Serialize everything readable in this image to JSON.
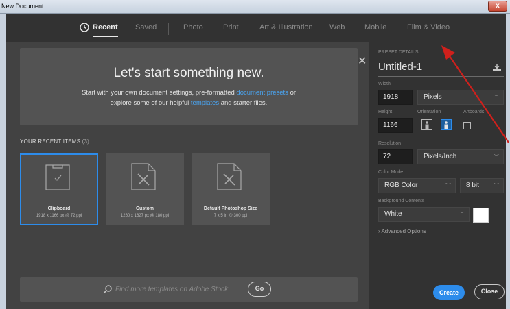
{
  "window": {
    "title": "New Document",
    "close_glyph": "x"
  },
  "tabs": [
    {
      "label": "Recent",
      "active": true
    },
    {
      "label": "Saved"
    },
    {
      "label": "Photo"
    },
    {
      "label": "Print"
    },
    {
      "label": "Art & Illustration"
    },
    {
      "label": "Web"
    },
    {
      "label": "Mobile"
    },
    {
      "label": "Film & Video"
    }
  ],
  "hero": {
    "title": "Let's start something new.",
    "text_1": "Start with your own document settings, pre-formatted ",
    "link_1": "document presets",
    "text_2": " or explore some of our helpful ",
    "link_2": "templates",
    "text_3": " and starter files.",
    "close_glyph": "✕"
  },
  "recent": {
    "label": "YOUR RECENT ITEMS",
    "count": "(3)",
    "items": [
      {
        "name": "Clipboard",
        "meta": "1918 x 1166 px @ 72 ppi",
        "icon": "clipboard-icon"
      },
      {
        "name": "Custom",
        "meta": "1260 x 1627 px @ 180 ppi",
        "icon": "document-icon"
      },
      {
        "name": "Default Photoshop Size",
        "meta": "7 x 5 in @ 300 ppi",
        "icon": "document-icon"
      }
    ]
  },
  "stock": {
    "placeholder": "Find more templates on Adobe Stock",
    "go_label": "Go"
  },
  "preset": {
    "section_label": "PRESET DETAILS",
    "name": "Untitled-1",
    "width_label": "Width",
    "width_value": "1918",
    "width_unit": "Pixels",
    "height_label": "Height",
    "height_value": "1166",
    "orientation_label": "Orientation",
    "artboards_label": "Artboards",
    "resolution_label": "Resolution",
    "resolution_value": "72",
    "resolution_unit": "Pixels/Inch",
    "color_mode_label": "Color Mode",
    "color_mode_value": "RGB Color",
    "bit_depth_value": "8 bit",
    "background_label": "Background Contents",
    "background_value": "White",
    "advanced_label": "Advanced Options"
  },
  "actions": {
    "create_label": "Create",
    "close_label": "Close"
  },
  "colors": {
    "accent": "#2d8ceb",
    "panel": "#323232",
    "main": "#424242",
    "annotation_arrow": "#d0201c"
  }
}
